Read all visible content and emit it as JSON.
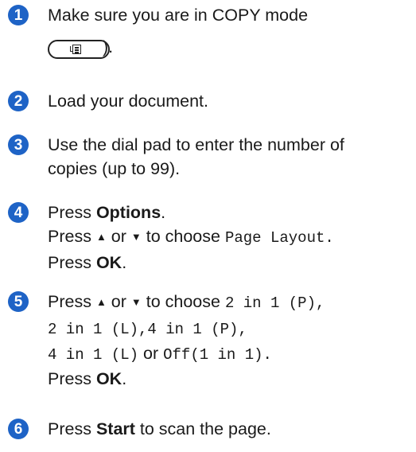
{
  "steps": [
    {
      "num": "1",
      "line1": "Make sure you are in COPY mode",
      "end": ")."
    },
    {
      "num": "2",
      "line1": "Load your document."
    },
    {
      "num": "3",
      "line1": "Use the dial pad to enter the number of",
      "line2": "copies (up to 99)."
    },
    {
      "num": "4",
      "press": "Press ",
      "options": "Options",
      "period": ".",
      "press_tri": "Press ",
      "or": " or ",
      "to_choose": " to choose ",
      "page_layout": "Page Layout.",
      "press2": "Press ",
      "ok": "OK",
      "period2": "."
    },
    {
      "num": "5",
      "press_tri": "Press ",
      "or": " or ",
      "to_choose": " to choose ",
      "opt1": "2 in 1 (P),",
      "opt2": "2 in 1 (L),",
      "opt3": "4 in 1 (P),",
      "opt4": "4 in 1 (L)",
      "or2": " or ",
      "opt5": "Off(1 in 1).",
      "press2": "Press ",
      "ok": "OK",
      "period2": "."
    },
    {
      "num": "6",
      "press": "Press ",
      "start": "Start",
      "rest": " to scan the page."
    }
  ],
  "symbols": {
    "up": "▲",
    "down": "▼"
  },
  "icons": {
    "copy_key": "copy-mode-key-icon"
  },
  "colors": {
    "step_number_bg": "#1e63c6"
  }
}
